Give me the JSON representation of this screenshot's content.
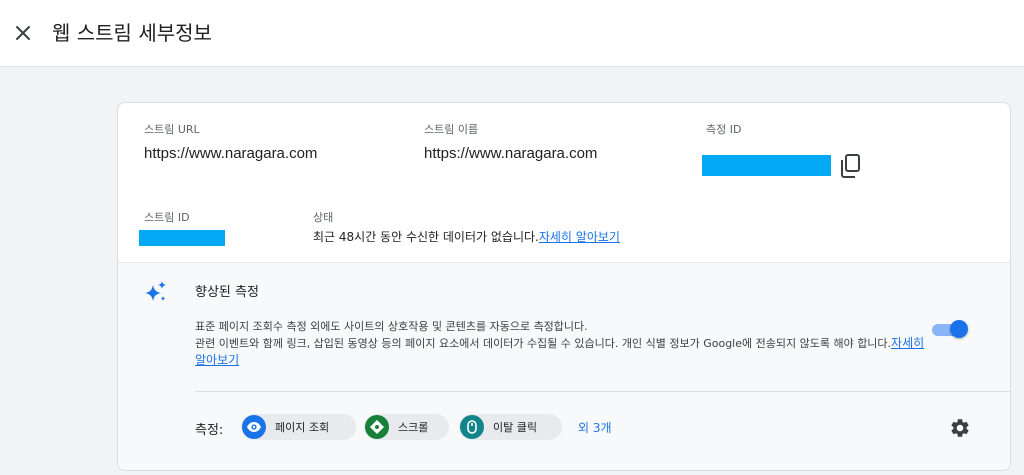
{
  "header": {
    "title": "웹 스트림 세부정보"
  },
  "details": {
    "stream_url_label": "스트림 URL",
    "stream_url_value": "https://www.naragara.com",
    "stream_name_label": "스트림 이름",
    "stream_name_value": "https://www.naragara.com",
    "measurement_id_label": "측정 ID",
    "stream_id_label": "스트림 ID",
    "status_label": "상태",
    "status_text": "최근 48시간 동안 수신한 데이터가 없습니다.",
    "status_link": "자세히 알아보기"
  },
  "enhanced": {
    "title": "향상된 측정",
    "desc_part1": "표준 페이지 조회수 측정 외에도 사이트의 상호작용 및 콘텐츠를 자동으로 측정합니다.",
    "desc_part2": "관련 이벤트와 함께 링크, 삽입된 동영상 등의 페이지 요소에서 데이터가 수집될 수 있습니다. 개인 식별 정보가 Google에 전송되지 않도록 해야 합니다.",
    "desc_link": "자세히 알아보기",
    "toggle_on": true,
    "measure_label": "측정:",
    "chips": [
      {
        "label": "페이지 조회",
        "icon": "eye-icon",
        "color": "#1a73e8"
      },
      {
        "label": "스크롤",
        "icon": "scroll-icon",
        "color": "#188038"
      },
      {
        "label": "이탈 클릭",
        "icon": "mouse-icon",
        "color": "#12858a"
      }
    ],
    "more_link": "외 3개"
  },
  "colors": {
    "accent": "#1a73e8",
    "redacted": "#03a9f4"
  }
}
